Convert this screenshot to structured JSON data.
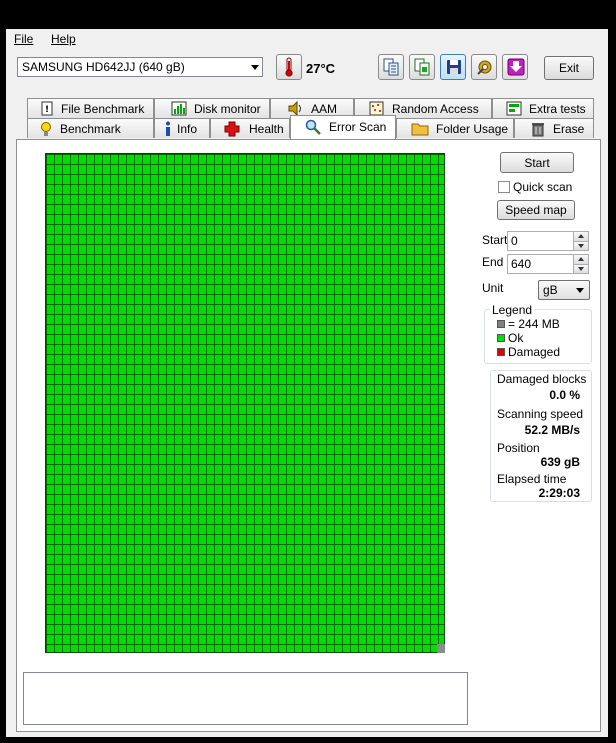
{
  "menu": {
    "file": "File",
    "help": "Help"
  },
  "toolbar": {
    "drive": "SAMSUNG HD642JJ (640 gB)",
    "temperature": "27°C",
    "exit_label": "Exit"
  },
  "tabs": {
    "row1": [
      "File Benchmark",
      "Disk monitor",
      "AAM",
      "Random Access",
      "Extra tests"
    ],
    "row2": [
      "Benchmark",
      "Info",
      "Health",
      "Error Scan",
      "Folder Usage",
      "Erase"
    ],
    "active": "Error Scan"
  },
  "controls": {
    "start_label": "Start",
    "quick_scan_label": "Quick scan",
    "quick_scan_checked": false,
    "speed_map_label": "Speed map",
    "start_field_label": "Start",
    "start_value": "0",
    "end_field_label": "End",
    "end_value": "640",
    "unit_label": "Unit",
    "unit_value": "gB"
  },
  "legend": {
    "title": "Legend",
    "items": [
      {
        "label": "= 244 MB",
        "color": "#808080"
      },
      {
        "label": "Ok",
        "color": "#00dd00"
      },
      {
        "label": "Damaged",
        "color": "#dd0000"
      }
    ]
  },
  "stats": {
    "damaged_blocks_label": "Damaged blocks",
    "damaged_blocks_value": "0.0 %",
    "scanning_speed_label": "Scanning speed",
    "scanning_speed_value": "52.2 MB/s",
    "position_label": "Position",
    "position_value": "639 gB",
    "elapsed_label": "Elapsed time",
    "elapsed_value": "2:29:03"
  },
  "colors": {
    "ok": "#00dd00",
    "damaged": "#dd0000",
    "pending": "#808080"
  }
}
